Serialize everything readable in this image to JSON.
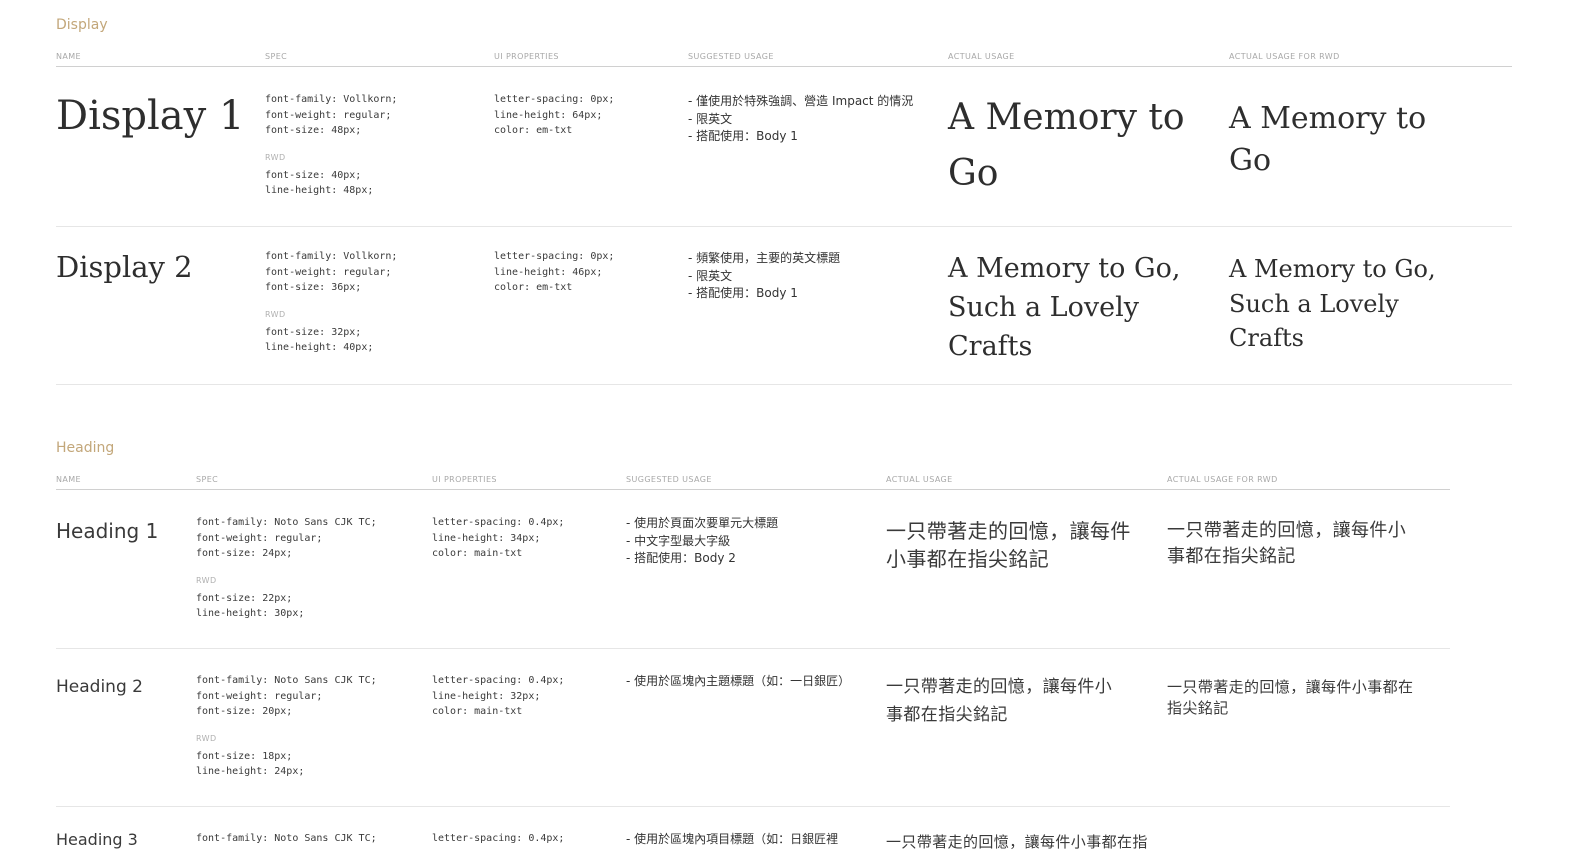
{
  "display": {
    "title": "Display",
    "headers": {
      "name": "NAME",
      "spec": "SPEC",
      "ui": "UI PROPERTIES",
      "suggested": "SUGGESTED USAGE",
      "actual": "ACTUAL USAGE",
      "actual_rwd": "ACTUAL USAGE FOR RWD"
    },
    "rows": [
      {
        "name": "Display 1",
        "spec": "font-family: Vollkorn;\nfont-weight: regular;\nfont-size: 48px;",
        "rwd_label": "RWD",
        "rwd": "font-size: 40px;\nline-height: 48px;",
        "ui": "letter-spacing: 0px;\nline-height: 64px;\ncolor: em-txt",
        "usage": [
          "僅使用於特殊強調、營造 Impact 的情況",
          "限英文",
          "搭配使用：Body 1"
        ],
        "actual": "A Memory to Go",
        "actual_rwd": "A Memory to Go"
      },
      {
        "name": "Display 2",
        "spec": "font-family: Vollkorn;\nfont-weight: regular;\nfont-size: 36px;",
        "rwd_label": "RWD",
        "rwd": "font-size: 32px;\nline-height: 40px;",
        "ui": "letter-spacing: 0px;\nline-height: 46px;\ncolor: em-txt",
        "usage": [
          "頻繁使用，主要的英文標題",
          "限英文",
          "搭配使用：Body 1"
        ],
        "actual": "A Memory to Go, Such a Lovely Crafts",
        "actual_rwd": "A Memory to Go, Such a Lovely Crafts"
      }
    ]
  },
  "heading": {
    "title": "Heading",
    "headers": {
      "name": "NAME",
      "spec": "SPEC",
      "ui": "UI PROPERTIES",
      "suggested": "SUGGESTED USAGE",
      "actual": "ACTUAL USAGE",
      "actual_rwd": "ACTUAL USAGE FOR RWD"
    },
    "rows": [
      {
        "name": "Heading 1",
        "spec": "font-family: Noto Sans CJK TC;\nfont-weight: regular;\nfont-size: 24px;",
        "rwd_label": "RWD",
        "rwd": "font-size: 22px;\nline-height: 30px;",
        "ui": "letter-spacing: 0.4px;\nline-height: 34px;\ncolor: main-txt",
        "usage": [
          "使用於頁面次要單元大標題",
          "中文字型最大字級",
          "搭配使用：Body 2"
        ],
        "actual": "一只帶著走的回憶，讓每件小事都在指尖銘記",
        "actual_rwd": "一只帶著走的回憶，讓每件小事都在指尖銘記"
      },
      {
        "name": "Heading 2",
        "spec": "font-family: Noto Sans CJK TC;\nfont-weight: regular;\nfont-size: 20px;",
        "rwd_label": "RWD",
        "rwd": "font-size: 18px;\nline-height: 24px;",
        "ui": "letter-spacing: 0.4px;\nline-height: 32px;\ncolor: main-txt",
        "usage": [
          "使用於區塊內主題標題（如：一日銀匠）"
        ],
        "actual": "一只帶著走的回憶，讓每件小事都在指尖銘記",
        "actual_rwd": "一只帶著走的回憶，讓每件小事都在指尖銘記"
      },
      {
        "name": "Heading 3",
        "spec": "font-family: Noto Sans CJK TC;",
        "ui": "letter-spacing: 0.4px;",
        "usage": [
          "使用於區塊內項目標題（如：日銀匠裡"
        ],
        "actual": "一只帶著走的回憶，讓每件小事都在指"
      }
    ]
  }
}
